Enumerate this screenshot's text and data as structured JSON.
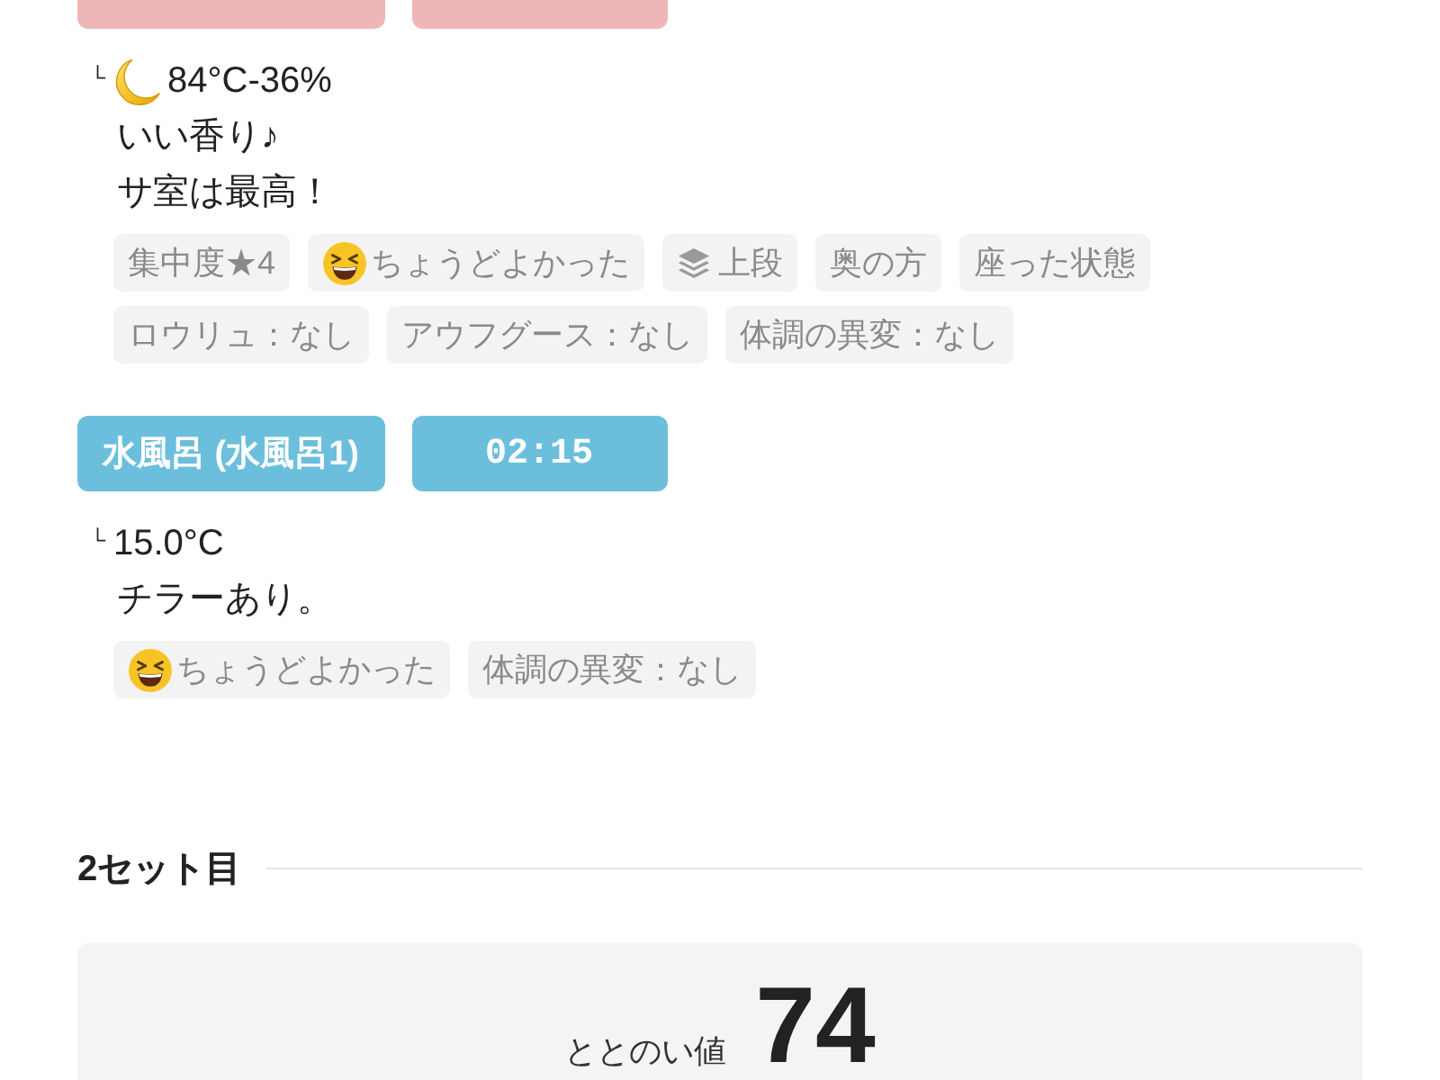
{
  "entries": [
    {
      "header_cut": true,
      "color": "#eeb6b6",
      "reading": {
        "corner": "└",
        "kind": "moon",
        "text": "84°C-36%"
      },
      "notes": [
        "いい香り♪",
        "サ室は最高！"
      ],
      "tags": [
        {
          "kind": "text",
          "label": "集中度★4"
        },
        {
          "kind": "mood",
          "label": "ちょうどよかった"
        },
        {
          "kind": "layers",
          "label": "上段"
        },
        {
          "kind": "text",
          "label": "奥の方"
        },
        {
          "kind": "text",
          "label": "座った状態"
        },
        {
          "kind": "text",
          "label": "ロウリュ：なし"
        },
        {
          "kind": "text",
          "label": "アウフグース：なし"
        },
        {
          "kind": "text",
          "label": "体調の異変：なし"
        }
      ]
    },
    {
      "header_cut": false,
      "color": "#6cbfdc",
      "name": "水風呂 (水風呂1)",
      "time": "02:15",
      "reading": {
        "corner": "└",
        "kind": "plain",
        "text": "15.0°C"
      },
      "notes": [
        "チラーあり。"
      ],
      "tags": [
        {
          "kind": "mood",
          "label": "ちょうどよかった"
        },
        {
          "kind": "text",
          "label": "体調の異変：なし"
        }
      ]
    }
  ],
  "section": {
    "title": "2セット目"
  },
  "score": {
    "label": "ととのい値",
    "value": "74"
  }
}
